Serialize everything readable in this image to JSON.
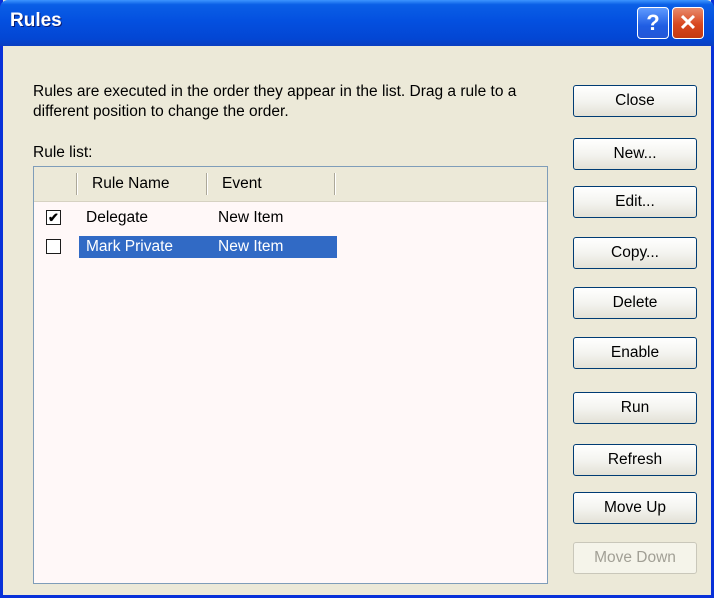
{
  "window": {
    "title": "Rules",
    "help_glyph": "?",
    "close_glyph": "✕"
  },
  "description": "Rules are executed in the order they appear in the list.  Drag a rule to a different position to change the order.",
  "list_label": "Rule list:",
  "columns": {
    "name": "Rule Name",
    "event": "Event"
  },
  "rules": [
    {
      "name": "Delegate",
      "event": "New Item",
      "enabled": true,
      "check_glyph": "✔",
      "selected": false
    },
    {
      "name": "Mark Private",
      "event": "New Item",
      "enabled": false,
      "check_glyph": "",
      "selected": true
    }
  ],
  "buttons": {
    "close": "Close",
    "new": "New...",
    "edit": "Edit...",
    "copy": "Copy...",
    "delete": "Delete",
    "enable": "Enable",
    "run": "Run",
    "refresh": "Refresh",
    "move_up": "Move Up",
    "move_down": "Move Down"
  },
  "colors": {
    "selection": "#316ac5",
    "titlebar": "#0450e0",
    "dialog_bg": "#ece9d8"
  }
}
